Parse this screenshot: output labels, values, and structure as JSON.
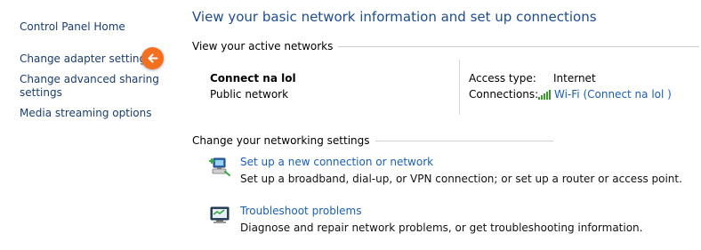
{
  "sidebar": {
    "items": [
      {
        "label": "Control Panel Home"
      },
      {
        "label": "Change adapter settings"
      },
      {
        "label": "Change advanced sharing settings"
      },
      {
        "label": "Media streaming options"
      }
    ]
  },
  "main": {
    "title": "View your basic network information and set up connections",
    "active_networks": {
      "heading": "View your active networks",
      "network_name": "Connect na lol",
      "network_type": "Public network",
      "access_type_label": "Access type:",
      "access_type_value": "Internet",
      "connections_label": "Connections:",
      "connections_value": "Wi-Fi (Connect na lol )"
    },
    "change_settings": {
      "heading": "Change your networking settings",
      "tasks": [
        {
          "link": "Set up a new connection or network",
          "desc": "Set up a broadband, dial-up, or VPN connection; or set up a router or access point."
        },
        {
          "link": "Troubleshoot problems",
          "desc": "Diagnose and repair network problems, or get troubleshooting information."
        }
      ]
    }
  },
  "colors": {
    "link": "#1a5fb4",
    "title": "#1e4d8c",
    "badge": "#f37021",
    "wifi": "#3a9a2c"
  },
  "icons": [
    "arrow-left-icon",
    "wifi-signal-icon",
    "network-setup-icon",
    "troubleshoot-icon"
  ]
}
